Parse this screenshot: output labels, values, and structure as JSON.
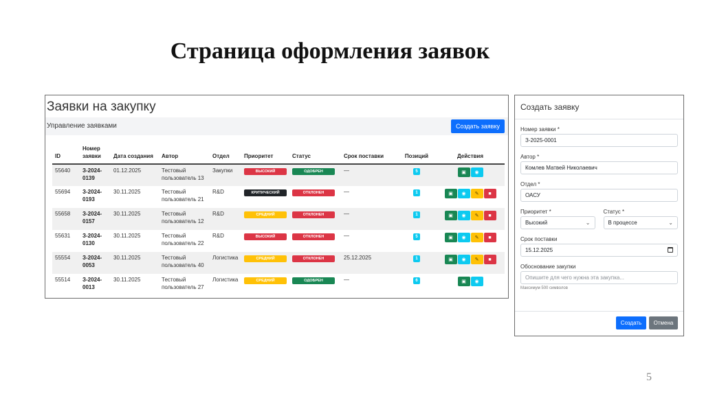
{
  "slide": {
    "title": "Страница оформления заявок",
    "page_number": "5"
  },
  "orders_panel": {
    "title": "Заявки на закупку",
    "subtitle": "Управление заявками",
    "create_button": "Создать заявку",
    "columns": {
      "id": "ID",
      "number": "Номер заявки",
      "created": "Дата создания",
      "author": "Автор",
      "department": "Отдел",
      "priority": "Приоритет",
      "status": "Статус",
      "deadline": "Срок поставки",
      "positions": "Позиций",
      "actions": "Действия"
    },
    "rows": [
      {
        "id": "55640",
        "number": "З-2024-0139",
        "created": "01.12.2025",
        "author": "Тестовый пользователь 13",
        "department": "Закупки",
        "priority": "ВЫСОКИЙ",
        "status": "ОДОБРЕН",
        "deadline": "—",
        "positions": "5"
      },
      {
        "id": "55694",
        "number": "З-2024-0193",
        "created": "30.11.2025",
        "author": "Тестовый пользователь 21",
        "department": "R&D",
        "priority": "КРИТИЧЕСКИЙ",
        "status": "ОТКЛОНЕН",
        "deadline": "—",
        "positions": "1"
      },
      {
        "id": "55658",
        "number": "З-2024-0157",
        "created": "30.11.2025",
        "author": "Тестовый пользователь 12",
        "department": "R&D",
        "priority": "СРЕДНИЙ",
        "status": "ОТКЛОНЕН",
        "deadline": "—",
        "positions": "1"
      },
      {
        "id": "55631",
        "number": "З-2024-0130",
        "created": "30.11.2025",
        "author": "Тестовый пользователь 22",
        "department": "R&D",
        "priority": "ВЫСОКИЙ",
        "status": "ОТКЛОНЕН",
        "deadline": "—",
        "positions": "5"
      },
      {
        "id": "55554",
        "number": "З-2024-0053",
        "created": "30.11.2025",
        "author": "Тестовый пользователь 40",
        "department": "Логистика",
        "priority": "СРЕДНИЙ",
        "status": "ОТКЛОНЕН",
        "deadline": "25.12.2025",
        "positions": "1"
      },
      {
        "id": "55514",
        "number": "З-2024-0013",
        "created": "30.11.2025",
        "author": "Тестовый пользователь 27",
        "department": "Логистика",
        "priority": "СРЕДНИЙ",
        "status": "ОДОБРЕН",
        "deadline": "—",
        "positions": "6"
      }
    ]
  },
  "form_panel": {
    "title": "Создать заявку",
    "number_label": "Номер заявки *",
    "number_value": "З-2025-0001",
    "author_label": "Автор *",
    "author_value": "Комлев Матвей Николаевич",
    "department_label": "Отдел *",
    "department_value": "ОАСУ",
    "priority_label": "Приоритет *",
    "priority_value": "Высокий",
    "status_label": "Статус *",
    "status_value": "В процессе",
    "deadline_label": "Срок поставки",
    "deadline_value": "15.12.2025",
    "justification_label": "Обоснование закупки",
    "justification_placeholder": "Опишите для чего нужна эта закупка...",
    "justification_hint": "Максимум 500 символов",
    "submit_button": "Создать",
    "cancel_button": "Отмена"
  },
  "colors": {
    "primary": "#0d6efd",
    "priority_high": "#dc3545",
    "priority_critical": "#212529",
    "priority_medium": "#ffc107",
    "status_approved": "#198754",
    "status_rejected": "#dc3545",
    "positions_badge": "#0dcaf0"
  },
  "icons": {
    "view": "box-icon",
    "details": "eye-icon",
    "edit": "pencil-icon",
    "delete": "trash-icon",
    "select": "chevron-down-icon",
    "date": "calendar-icon"
  }
}
